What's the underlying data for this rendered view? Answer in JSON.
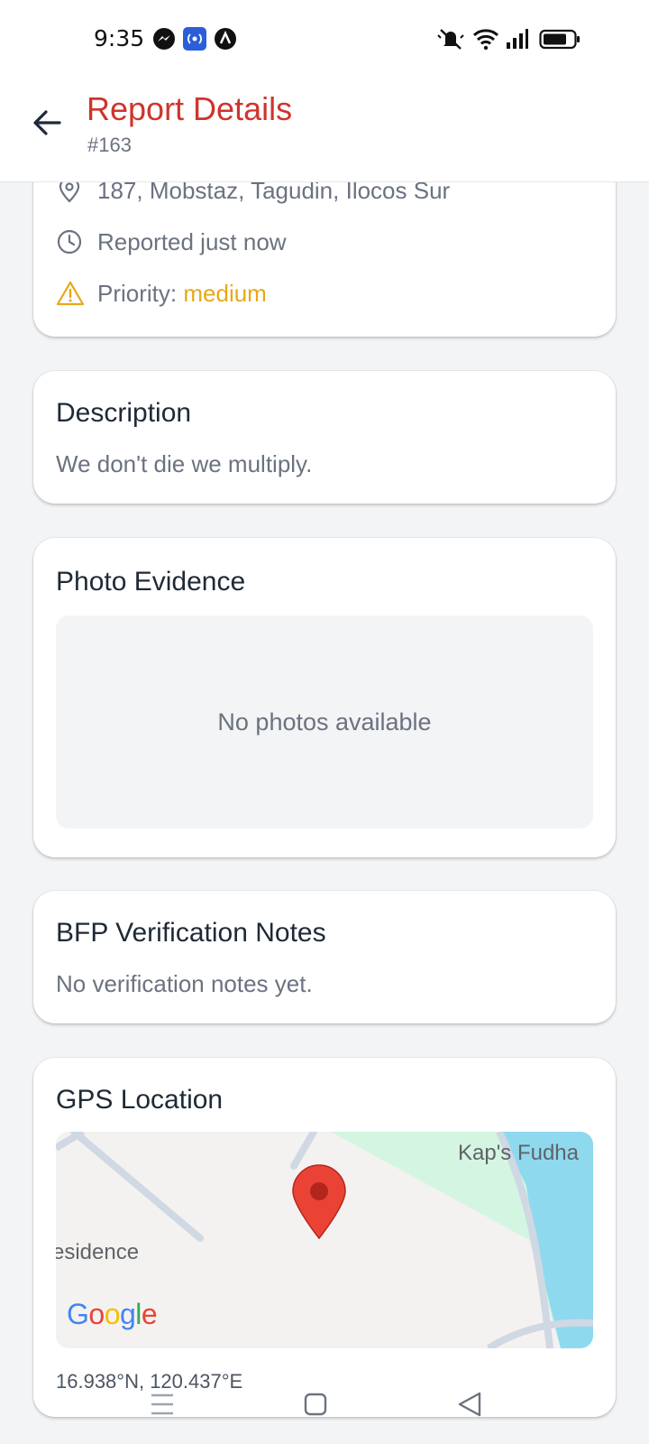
{
  "status_bar": {
    "time": "9:35",
    "left_icons": [
      "messenger-icon",
      "broadcast-icon",
      "app-a-icon"
    ],
    "right_icons": [
      "mute-icon",
      "wifi-icon",
      "signal-icon",
      "battery-icon"
    ]
  },
  "header": {
    "title": "Report Details",
    "subtitle": "#163",
    "back_icon": "arrow-left-icon"
  },
  "report_info": {
    "address": "187, Mobstaz, Tagudin, Ilocos Sur",
    "reported": "Reported just now",
    "priority_label": "Priority:",
    "priority_value": "medium"
  },
  "description": {
    "title": "Description",
    "text": "We don't die we multiply."
  },
  "photo_evidence": {
    "title": "Photo Evidence",
    "empty_text": "No photos available"
  },
  "verification_notes": {
    "title": "BFP Verification Notes",
    "empty_text": "No verification notes yet."
  },
  "gps": {
    "title": "GPS Location",
    "map_labels": [
      "Kap's Fudha",
      "esidence"
    ],
    "map_brand": "Google",
    "coordinates": "16.938°N, 120.437°E"
  },
  "colors": {
    "title_red": "#d0342c",
    "priority_medium": "#e6a817",
    "marker_red": "#ea4335"
  },
  "nav_bar": [
    "menu-icon",
    "home-icon",
    "back-triangle-icon"
  ]
}
